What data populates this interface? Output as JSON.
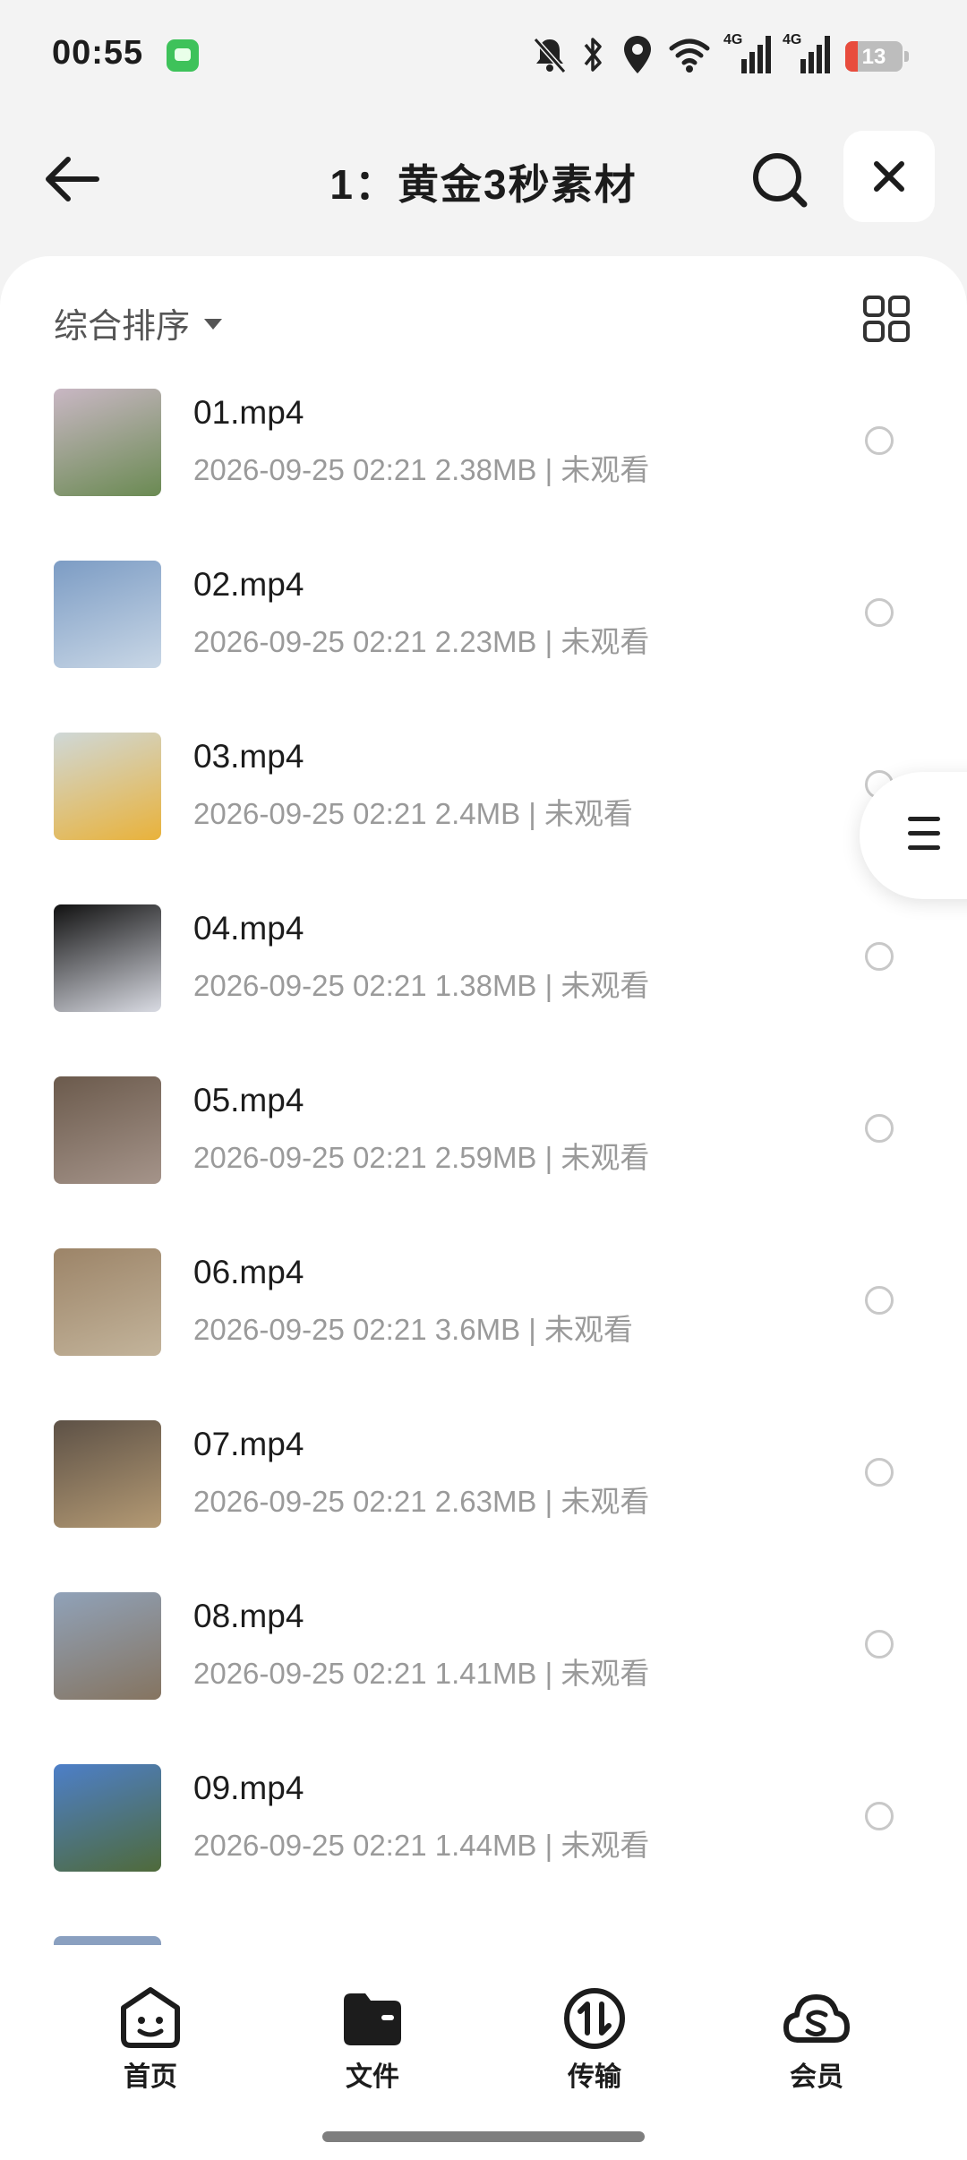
{
  "status_bar": {
    "time": "00:55",
    "network_1": "4G",
    "network_2": "4G",
    "battery_level": "13",
    "icons": [
      "message-app-icon",
      "mute-bell-icon",
      "bluetooth-icon",
      "location-icon",
      "wifi-icon",
      "signal-icon",
      "signal-icon",
      "battery-icon"
    ]
  },
  "header": {
    "title": "1：黄金3秒素材",
    "icons": [
      "back-arrow-icon",
      "search-icon",
      "close-icon"
    ]
  },
  "sort": {
    "label": "综合排序"
  },
  "files": [
    {
      "name": "01.mp4",
      "meta": "2026-09-25 02:21  2.38MB | 未观看",
      "thumb": [
        "#c9b7c4",
        "#6a8a52"
      ]
    },
    {
      "name": "02.mp4",
      "meta": "2026-09-25 02:21  2.23MB | 未观看",
      "thumb": [
        "#7c9cc4",
        "#c9d7e6"
      ]
    },
    {
      "name": "03.mp4",
      "meta": "2026-09-25 02:21  2.4MB | 未观看",
      "thumb": [
        "#cfd8d8",
        "#e9b23a"
      ]
    },
    {
      "name": "04.mp4",
      "meta": "2026-09-25 02:21  1.38MB | 未观看",
      "thumb": [
        "#111111",
        "#d9dbe3"
      ]
    },
    {
      "name": "05.mp4",
      "meta": "2026-09-25 02:21  2.59MB | 未观看",
      "thumb": [
        "#6b5a4c",
        "#a5948a"
      ]
    },
    {
      "name": "06.mp4",
      "meta": "2026-09-25 02:21  3.6MB | 未观看",
      "thumb": [
        "#9c8468",
        "#c3b49b"
      ]
    },
    {
      "name": "07.mp4",
      "meta": "2026-09-25 02:21  2.63MB | 未观看",
      "thumb": [
        "#5d5146",
        "#b49a74"
      ]
    },
    {
      "name": "08.mp4",
      "meta": "2026-09-25 02:21  1.41MB | 未观看",
      "thumb": [
        "#90a2b9",
        "#857460"
      ]
    },
    {
      "name": "09.mp4",
      "meta": "2026-09-25 02:21  1.44MB | 未观看",
      "thumb": [
        "#4d7fc9",
        "#4f6a3a"
      ]
    }
  ],
  "bottom_nav": [
    {
      "label": "首页",
      "icon": "smiley-home-icon"
    },
    {
      "label": "文件",
      "icon": "folder-icon"
    },
    {
      "label": "传输",
      "icon": "transfer-icon"
    },
    {
      "label": "会员",
      "icon": "cloud-member-icon"
    }
  ],
  "colors": {
    "accent": "#1c1c1c",
    "meta": "#9a9a9a",
    "background": "#f3f3f3",
    "battery_low": "#e84c3d"
  }
}
